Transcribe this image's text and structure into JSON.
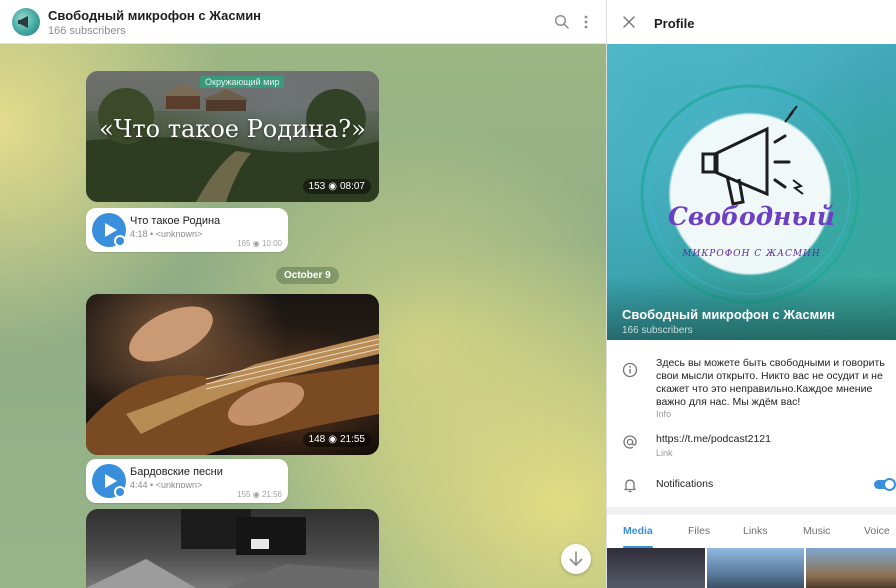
{
  "chat": {
    "title": "Свободный микрофон с Жасмин",
    "subscribers": "166 subscribers",
    "posts": [
      {
        "tag": "Окружающий мир",
        "heading": "«Что такое Родина?»",
        "views": "153",
        "time": "08:07",
        "audio": {
          "title": "Что такое Родина",
          "duration": "4:18",
          "performer": "<unknown>",
          "views": "165",
          "time": "10:00"
        }
      },
      {
        "views": "148",
        "time": "21:55",
        "audio": {
          "title": "Бардовские песни",
          "duration": "4:44",
          "performer": "<unknown>",
          "views": "155",
          "time": "21:56"
        }
      }
    ],
    "date_separator": "October 9",
    "meta_separator": "•"
  },
  "profile": {
    "title": "Profile",
    "cover": {
      "logo_line1": "Свободный",
      "logo_line2": "МИКРОФОН С ЖАСМИН",
      "name": "Свободный микрофон с Жасмин",
      "subscribers": "166 subscribers"
    },
    "about": {
      "text": "Здесь вы можете быть свободными и говорить свои мысли открыто. Никто вас не осудит и не скажет что это неправильно.Каждое мнение важно для нас. Мы ждём вас!",
      "caption": "Info"
    },
    "link": {
      "url": "https://t.me/podcast2121",
      "caption": "Link"
    },
    "notifications": {
      "label": "Notifications",
      "enabled": true
    },
    "tabs": [
      "Media",
      "Files",
      "Links",
      "Music",
      "Voice"
    ],
    "active_tab": "Media"
  },
  "colors": {
    "accent": "#3a8fdc",
    "tag_green": "#3a9a7c"
  }
}
